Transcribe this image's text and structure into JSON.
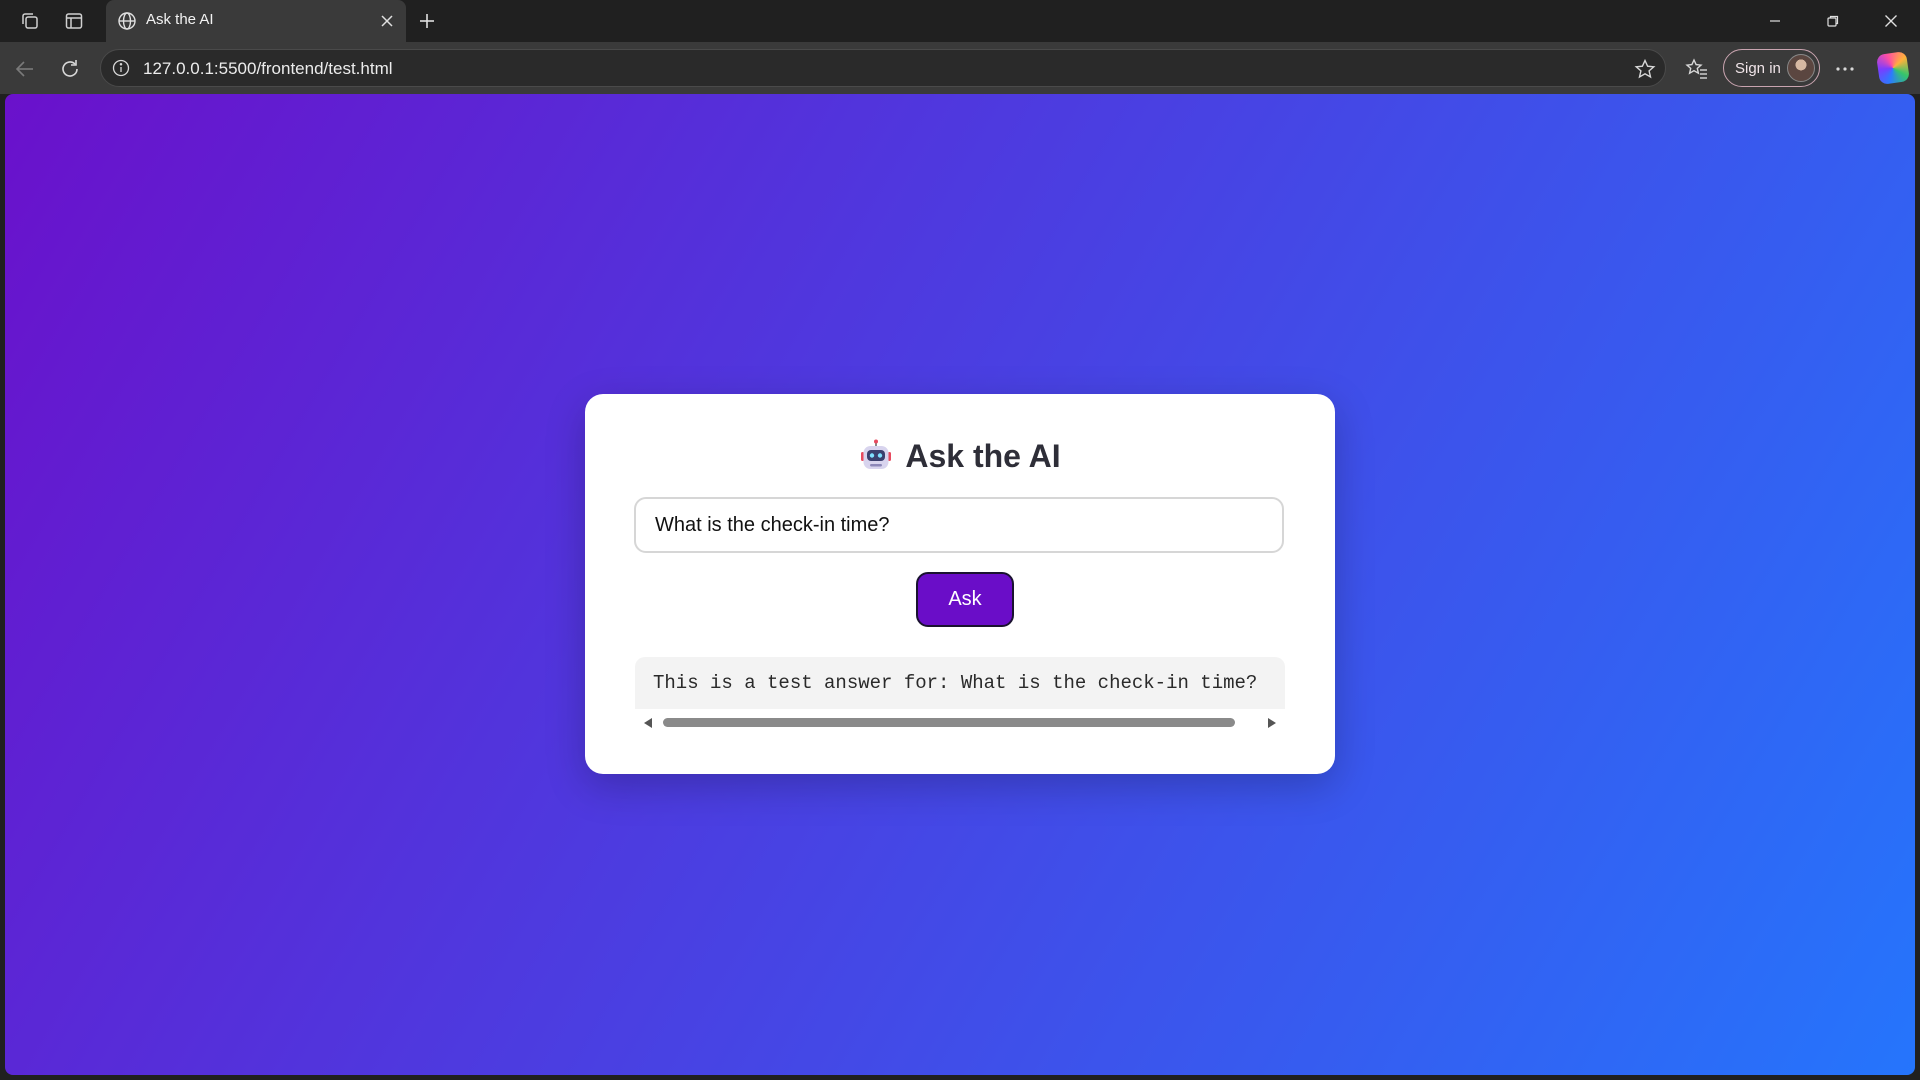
{
  "browser": {
    "tab": {
      "title": "Ask the AI"
    },
    "address_bar": {
      "url": "127.0.0.1:5500/frontend/test.html"
    },
    "toolbar": {
      "sign_in_label": "Sign in"
    }
  },
  "page": {
    "title": "Ask the AI",
    "question_input": {
      "value": "What is the check-in time?"
    },
    "ask_button_label": "Ask",
    "answer": "This is a test answer for: What is the check-in time?"
  },
  "colors": {
    "gradient_start": "#6a11cb",
    "gradient_end": "#2575fc",
    "button": "#6a0dc8",
    "card": "#ffffff"
  },
  "icons": {
    "title_icon": "robot-icon"
  }
}
